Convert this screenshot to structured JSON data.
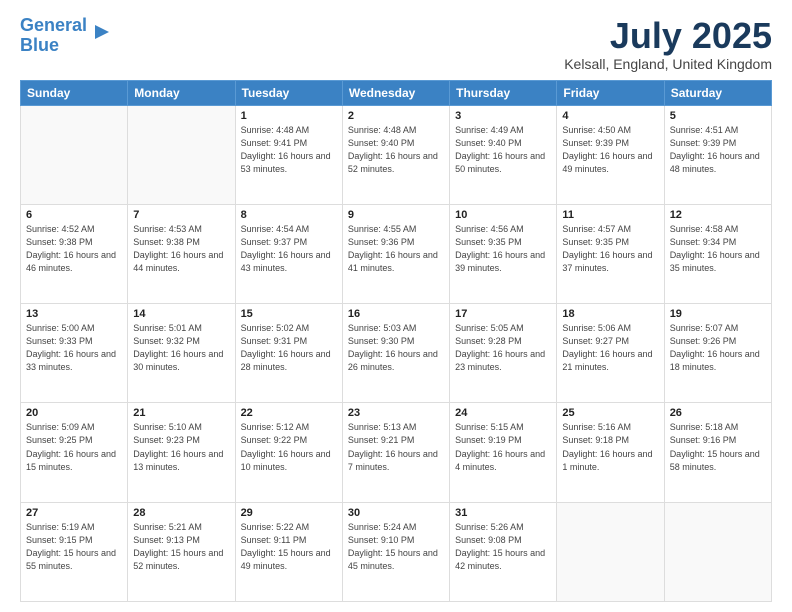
{
  "logo": {
    "line1": "General",
    "line2": "Blue"
  },
  "title": "July 2025",
  "location": "Kelsall, England, United Kingdom",
  "days_of_week": [
    "Sunday",
    "Monday",
    "Tuesday",
    "Wednesday",
    "Thursday",
    "Friday",
    "Saturday"
  ],
  "weeks": [
    [
      {
        "day": "",
        "info": ""
      },
      {
        "day": "",
        "info": ""
      },
      {
        "day": "1",
        "info": "Sunrise: 4:48 AM\nSunset: 9:41 PM\nDaylight: 16 hours and 53 minutes."
      },
      {
        "day": "2",
        "info": "Sunrise: 4:48 AM\nSunset: 9:40 PM\nDaylight: 16 hours and 52 minutes."
      },
      {
        "day": "3",
        "info": "Sunrise: 4:49 AM\nSunset: 9:40 PM\nDaylight: 16 hours and 50 minutes."
      },
      {
        "day": "4",
        "info": "Sunrise: 4:50 AM\nSunset: 9:39 PM\nDaylight: 16 hours and 49 minutes."
      },
      {
        "day": "5",
        "info": "Sunrise: 4:51 AM\nSunset: 9:39 PM\nDaylight: 16 hours and 48 minutes."
      }
    ],
    [
      {
        "day": "6",
        "info": "Sunrise: 4:52 AM\nSunset: 9:38 PM\nDaylight: 16 hours and 46 minutes."
      },
      {
        "day": "7",
        "info": "Sunrise: 4:53 AM\nSunset: 9:38 PM\nDaylight: 16 hours and 44 minutes."
      },
      {
        "day": "8",
        "info": "Sunrise: 4:54 AM\nSunset: 9:37 PM\nDaylight: 16 hours and 43 minutes."
      },
      {
        "day": "9",
        "info": "Sunrise: 4:55 AM\nSunset: 9:36 PM\nDaylight: 16 hours and 41 minutes."
      },
      {
        "day": "10",
        "info": "Sunrise: 4:56 AM\nSunset: 9:35 PM\nDaylight: 16 hours and 39 minutes."
      },
      {
        "day": "11",
        "info": "Sunrise: 4:57 AM\nSunset: 9:35 PM\nDaylight: 16 hours and 37 minutes."
      },
      {
        "day": "12",
        "info": "Sunrise: 4:58 AM\nSunset: 9:34 PM\nDaylight: 16 hours and 35 minutes."
      }
    ],
    [
      {
        "day": "13",
        "info": "Sunrise: 5:00 AM\nSunset: 9:33 PM\nDaylight: 16 hours and 33 minutes."
      },
      {
        "day": "14",
        "info": "Sunrise: 5:01 AM\nSunset: 9:32 PM\nDaylight: 16 hours and 30 minutes."
      },
      {
        "day": "15",
        "info": "Sunrise: 5:02 AM\nSunset: 9:31 PM\nDaylight: 16 hours and 28 minutes."
      },
      {
        "day": "16",
        "info": "Sunrise: 5:03 AM\nSunset: 9:30 PM\nDaylight: 16 hours and 26 minutes."
      },
      {
        "day": "17",
        "info": "Sunrise: 5:05 AM\nSunset: 9:28 PM\nDaylight: 16 hours and 23 minutes."
      },
      {
        "day": "18",
        "info": "Sunrise: 5:06 AM\nSunset: 9:27 PM\nDaylight: 16 hours and 21 minutes."
      },
      {
        "day": "19",
        "info": "Sunrise: 5:07 AM\nSunset: 9:26 PM\nDaylight: 16 hours and 18 minutes."
      }
    ],
    [
      {
        "day": "20",
        "info": "Sunrise: 5:09 AM\nSunset: 9:25 PM\nDaylight: 16 hours and 15 minutes."
      },
      {
        "day": "21",
        "info": "Sunrise: 5:10 AM\nSunset: 9:23 PM\nDaylight: 16 hours and 13 minutes."
      },
      {
        "day": "22",
        "info": "Sunrise: 5:12 AM\nSunset: 9:22 PM\nDaylight: 16 hours and 10 minutes."
      },
      {
        "day": "23",
        "info": "Sunrise: 5:13 AM\nSunset: 9:21 PM\nDaylight: 16 hours and 7 minutes."
      },
      {
        "day": "24",
        "info": "Sunrise: 5:15 AM\nSunset: 9:19 PM\nDaylight: 16 hours and 4 minutes."
      },
      {
        "day": "25",
        "info": "Sunrise: 5:16 AM\nSunset: 9:18 PM\nDaylight: 16 hours and 1 minute."
      },
      {
        "day": "26",
        "info": "Sunrise: 5:18 AM\nSunset: 9:16 PM\nDaylight: 15 hours and 58 minutes."
      }
    ],
    [
      {
        "day": "27",
        "info": "Sunrise: 5:19 AM\nSunset: 9:15 PM\nDaylight: 15 hours and 55 minutes."
      },
      {
        "day": "28",
        "info": "Sunrise: 5:21 AM\nSunset: 9:13 PM\nDaylight: 15 hours and 52 minutes."
      },
      {
        "day": "29",
        "info": "Sunrise: 5:22 AM\nSunset: 9:11 PM\nDaylight: 15 hours and 49 minutes."
      },
      {
        "day": "30",
        "info": "Sunrise: 5:24 AM\nSunset: 9:10 PM\nDaylight: 15 hours and 45 minutes."
      },
      {
        "day": "31",
        "info": "Sunrise: 5:26 AM\nSunset: 9:08 PM\nDaylight: 15 hours and 42 minutes."
      },
      {
        "day": "",
        "info": ""
      },
      {
        "day": "",
        "info": ""
      }
    ]
  ]
}
